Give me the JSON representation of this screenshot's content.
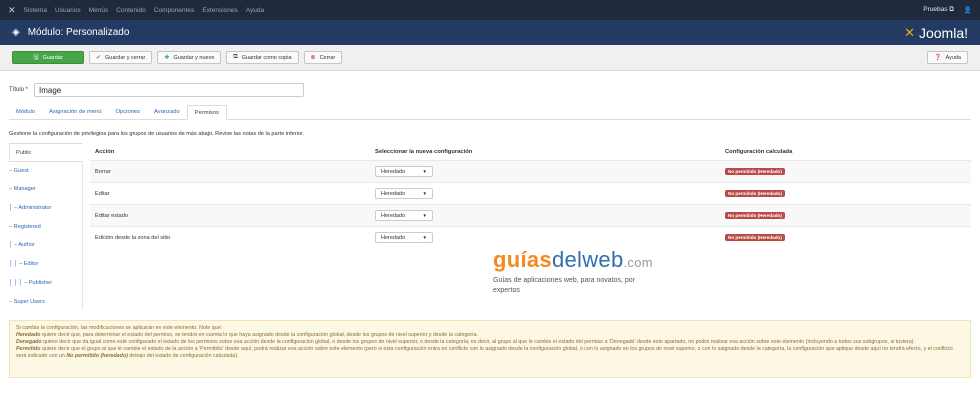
{
  "topbar": {
    "menu": [
      "Sistema",
      "Usuarios",
      "Menús",
      "Contenido",
      "Componentes",
      "Extensiones",
      "Ayuda"
    ],
    "site_label": "Pruebas ⧉",
    "user_icon": "user-icon"
  },
  "header": {
    "title": "Módulo: Personalizado",
    "logo_text": "Joomla!"
  },
  "toolbar": {
    "save": "Guardar",
    "save_close": "Guardar y cerrar",
    "save_new": "Guardar y nuevo",
    "save_copy": "Guardar como copia",
    "close": "Cerrar",
    "help": "Ayuda"
  },
  "form": {
    "title_label": "Título *",
    "title_value": "Image"
  },
  "tabs": [
    "Módulo",
    "Asignación de menú",
    "Opciones",
    "Avanzado",
    "Permisos"
  ],
  "active_tab": "Permisos",
  "permissions": {
    "intro": "Gestione la configuración de privilegios para los grupos de usuarios de más abajo. Revise las notas de la parte inferior.",
    "groups": [
      "Public",
      "– Guest",
      "– Manager",
      "│ – Administrator",
      "– Registered",
      "│ – Author",
      "│ │ – Editor",
      "│ │ │ – Publisher",
      "– Super Users"
    ],
    "columns": [
      "Acción",
      "Seleccionar la nueva configuración",
      "Configuración calculada"
    ],
    "rows": [
      {
        "action": "Borrar",
        "setting": "Heredado",
        "calculated": "No permitido (Heredado)"
      },
      {
        "action": "Editar",
        "setting": "Heredado",
        "calculated": "No permitido (Heredado)"
      },
      {
        "action": "Editar estado",
        "setting": "Heredado",
        "calculated": "No permitido (Heredado)"
      },
      {
        "action": "Edición desde la zona del sitio",
        "setting": "Heredado",
        "calculated": "No permitido (Heredado)"
      }
    ]
  },
  "watermark": {
    "brand_a": "guías",
    "brand_b": "delweb",
    "brand_c": ".com",
    "tagline_1": "Guías de aplicaciones web, para novatos, por",
    "tagline_2": "expertos"
  },
  "notice": {
    "line1": "Si cambia la configuración, las modificaciones se aplicarán en este elemento. Note que:",
    "heredado_term": "Heredado",
    "heredado_text": " quiere decir que, para determinar el estado del permiso, se tendrá en cuenta lo que haya asignado desde la configuración global, desde los grupos de nivel superior y desde la categoría.",
    "denegado_term": "Denegado",
    "denegado_text": " quiere decir que da igual como esté configurado el estado de los permisos sobre esa acción desde la configuración global, o desde los grupos de nivel superior, o desde la categoría; es decir, al grupo al que le cambie el estado del permiso a 'Denegado' desde este apartado, no podrá realizar esa acción sobre este elemento (incluyendo a todos sus subgrupos, si tuviera).",
    "permitido_term": "Permitido",
    "permitido_text": " quiere decir que el grupo al que le cambie el estado de la acción a 'Permitido' desde aquí, podrá realizar esa acción sobre este elemento (pero si esta configuración entra en conflicto con lo asignado desde la configuración global, o con lo asignado en los grupos de nivel superior, o con lo asignado desde la categoría, la configuración que aplique desde aquí no tendrá efecto, y el conflicto será indicado con un ",
    "conflict_term": "No permitido (heredado)",
    "conflict_text": " debajo del estado de configuración calculada)."
  },
  "colors": {
    "topbar": "#1f2a3c",
    "header": "#233b63",
    "save_green": "#46a546",
    "badge_red": "#b94a48",
    "link_blue": "#2a69b8",
    "notice_bg": "#fcf8e3"
  }
}
